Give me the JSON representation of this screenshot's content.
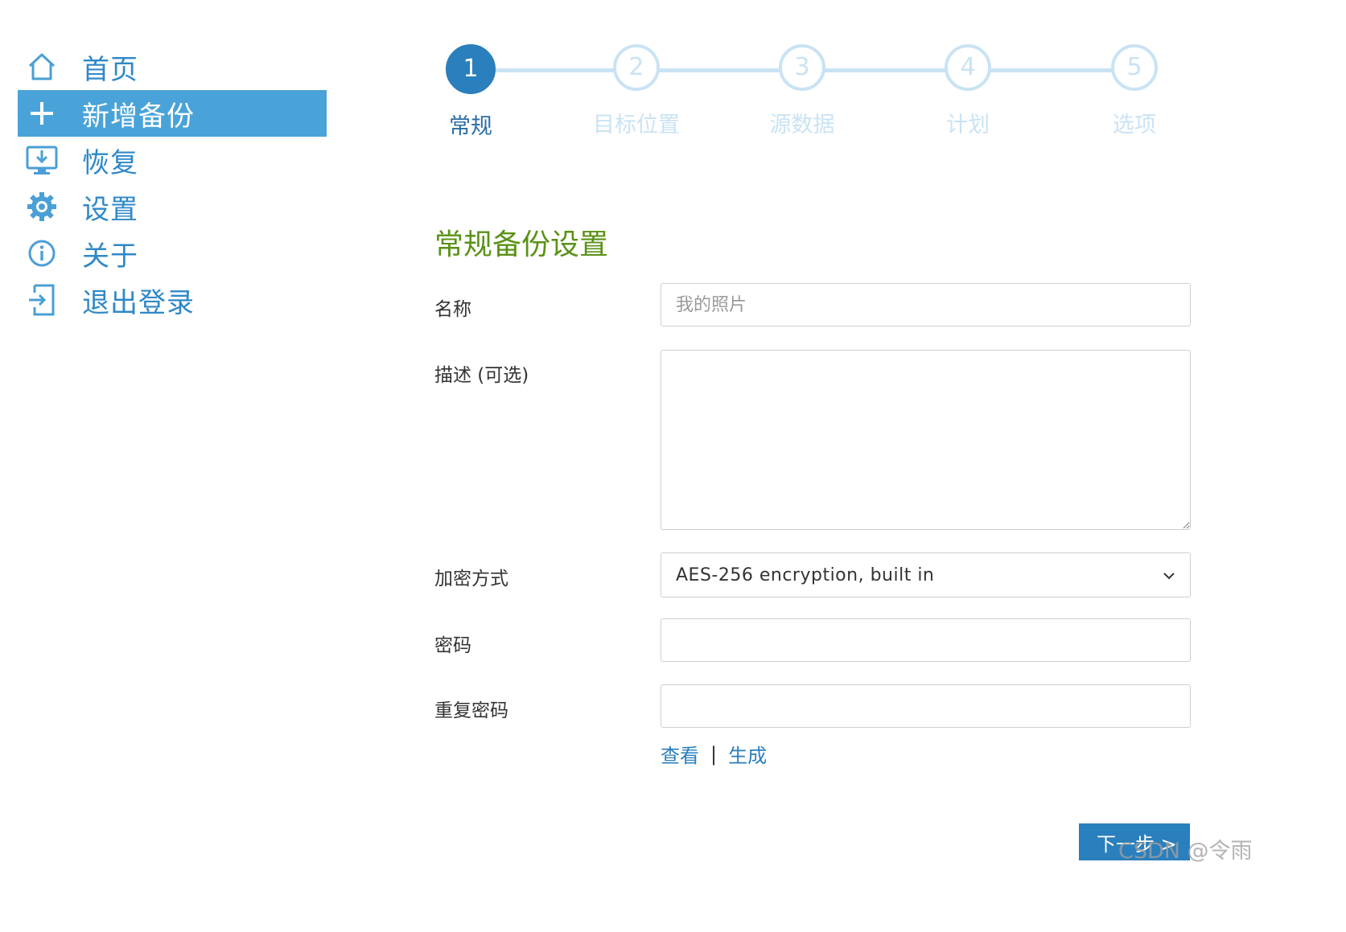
{
  "sidebar": {
    "items": [
      {
        "label": "首页",
        "icon": "home-icon"
      },
      {
        "label": "新增备份",
        "icon": "plus-icon",
        "active": true
      },
      {
        "label": "恢复",
        "icon": "restore-monitor-icon"
      },
      {
        "label": "设置",
        "icon": "gear-icon"
      },
      {
        "label": "关于",
        "icon": "info-icon"
      },
      {
        "label": "退出登录",
        "icon": "logout-icon"
      }
    ]
  },
  "stepper": {
    "steps": [
      {
        "number": "1",
        "label": "常规",
        "active": true
      },
      {
        "number": "2",
        "label": "目标位置"
      },
      {
        "number": "3",
        "label": "源数据"
      },
      {
        "number": "4",
        "label": "计划"
      },
      {
        "number": "5",
        "label": "选项"
      }
    ]
  },
  "form": {
    "title": "常规备份设置",
    "name_label": "名称",
    "name_placeholder": "我的照片",
    "name_value": "",
    "description_label": "描述 (可选)",
    "description_value": "",
    "encryption_label": "加密方式",
    "encryption_value": "AES-256 encryption, built in",
    "password_label": "密码",
    "password_value": "",
    "repeat_password_label": "重复密码",
    "repeat_password_value": "",
    "view_link": "查看",
    "separator": "|",
    "generate_link": "生成",
    "next_button": "下一步 >"
  },
  "watermark": "CSDN @令雨",
  "colors": {
    "accent": "#2a7fbd",
    "sidebar_active_bg": "#4aa3d8",
    "sidebar_text": "#2f88c8",
    "step_inactive": "#c9e3f4",
    "title_green": "#5a9216"
  }
}
